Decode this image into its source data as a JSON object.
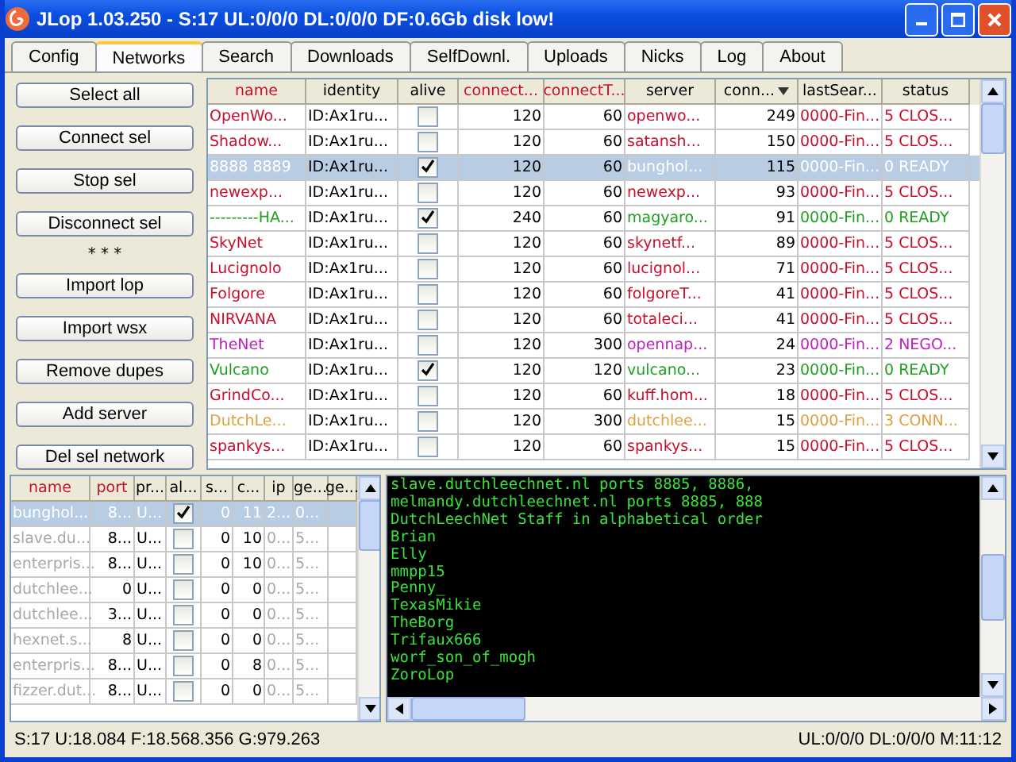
{
  "window": {
    "title": "JLop 1.03.250 - S:17 UL:0/0/0 DL:0/0/0  DF:0.6Gb disk low!"
  },
  "tabs": [
    {
      "label": "Config",
      "selected": false
    },
    {
      "label": "Networks",
      "selected": true
    },
    {
      "label": "Search",
      "selected": false
    },
    {
      "label": "Downloads",
      "selected": false
    },
    {
      "label": "SelfDownl.",
      "selected": false
    },
    {
      "label": "Uploads",
      "selected": false
    },
    {
      "label": "Nicks",
      "selected": false
    },
    {
      "label": "Log",
      "selected": false
    },
    {
      "label": "About",
      "selected": false
    }
  ],
  "sidebar": {
    "buttons": [
      "Select all",
      "Connect sel",
      "Stop sel",
      "Disconnect sel"
    ],
    "separator": "* * *",
    "buttons_2": [
      "Import lop",
      "Import wsx",
      "Remove dupes",
      "Add server",
      "Del sel network"
    ]
  },
  "networks_table": {
    "columns": [
      "name",
      "identity",
      "alive",
      "connect...",
      "connectT...",
      "server",
      "conn...",
      "lastSear...",
      "status"
    ],
    "rows": [
      {
        "name": "OpenWo...",
        "identity": "ID:Ax1ru...",
        "alive": false,
        "connect": "120",
        "connectT": "60",
        "server": "openwo...",
        "conn": "249",
        "lastSearch": "0000-Fin...",
        "status": "5 CLOS...",
        "color": "#c8102e",
        "selected": false
      },
      {
        "name": "Shadow...",
        "identity": "ID:Ax1ru...",
        "alive": false,
        "connect": "120",
        "connectT": "60",
        "server": "satansh...",
        "conn": "150",
        "lastSearch": "0000-Fin...",
        "status": "5 CLOS...",
        "color": "#c8102e",
        "selected": false
      },
      {
        "name": "8888 8889",
        "identity": "ID:Ax1ru...",
        "alive": true,
        "connect": "120",
        "connectT": "60",
        "server": "bunghol...",
        "conn": "115",
        "lastSearch": "0000-Fin...",
        "status": "0 READY",
        "selected": true
      },
      {
        "name": "newexp...",
        "identity": "ID:Ax1ru...",
        "alive": false,
        "connect": "120",
        "connectT": "60",
        "server": "newexp...",
        "conn": "93",
        "lastSearch": "0000-Fin...",
        "status": "5 CLOS...",
        "color": "#c8102e",
        "selected": false
      },
      {
        "name": "---------HA...",
        "identity": "ID:Ax1ru...",
        "alive": true,
        "connect": "240",
        "connectT": "60",
        "server": "magyaro...",
        "conn": "91",
        "lastSearch": "0000-Fin...",
        "status": "0 READY",
        "color": "#20a020",
        "selected": false
      },
      {
        "name": "SkyNet",
        "identity": "ID:Ax1ru...",
        "alive": false,
        "connect": "120",
        "connectT": "60",
        "server": "skynetf...",
        "conn": "89",
        "lastSearch": "0000-Fin...",
        "status": "5 CLOS...",
        "color": "#c8102e",
        "selected": false
      },
      {
        "name": "Lucignolo",
        "identity": "ID:Ax1ru...",
        "alive": false,
        "connect": "120",
        "connectT": "60",
        "server": "lucignol...",
        "conn": "71",
        "lastSearch": "0000-Fin...",
        "status": "5 CLOS...",
        "color": "#c8102e",
        "selected": false
      },
      {
        "name": "Folgore",
        "identity": "ID:Ax1ru...",
        "alive": false,
        "connect": "120",
        "connectT": "60",
        "server": "folgoreT...",
        "conn": "41",
        "lastSearch": "0000-Fin...",
        "status": "5 CLOS...",
        "color": "#c8102e",
        "selected": false
      },
      {
        "name": "NIRVANA",
        "identity": "ID:Ax1ru...",
        "alive": false,
        "connect": "120",
        "connectT": "60",
        "server": "totaleci...",
        "conn": "41",
        "lastSearch": "0000-Fin...",
        "status": "5 CLOS...",
        "color": "#c8102e",
        "selected": false
      },
      {
        "name": "TheNet",
        "identity": "ID:Ax1ru...",
        "alive": false,
        "connect": "120",
        "connectT": "300",
        "server": "opennap...",
        "conn": "24",
        "lastSearch": "0000-Fin...",
        "status": "2 NEGO...",
        "color": "#c020c0",
        "selected": false
      },
      {
        "name": "Vulcano",
        "identity": "ID:Ax1ru...",
        "alive": true,
        "connect": "120",
        "connectT": "120",
        "server": "vulcano...",
        "conn": "23",
        "lastSearch": "0000-Fin...",
        "status": "0 READY",
        "color": "#20a020",
        "selected": false
      },
      {
        "name": "GrindCo...",
        "identity": "ID:Ax1ru...",
        "alive": false,
        "connect": "120",
        "connectT": "60",
        "server": "kuff.hom...",
        "conn": "18",
        "lastSearch": "0000-Fin...",
        "status": "5 CLOS...",
        "color": "#c8102e",
        "selected": false
      },
      {
        "name": "DutchLe...",
        "identity": "ID:Ax1ru...",
        "alive": false,
        "connect": "120",
        "connectT": "300",
        "server": "dutchlee...",
        "conn": "15",
        "lastSearch": "0000-Fin...",
        "status": "3 CONN...",
        "color": "#e0a040",
        "selected": false
      },
      {
        "name": "spankys...",
        "identity": "ID:Ax1ru...",
        "alive": false,
        "connect": "120",
        "connectT": "60",
        "server": "spankys...",
        "conn": "15",
        "lastSearch": "0000-Fin...",
        "status": "5 CLOS...",
        "color": "#c8102e",
        "selected": false
      }
    ]
  },
  "servers_table": {
    "columns": [
      "name",
      "port",
      "pr...",
      "al...",
      "s...",
      "c...",
      "ip",
      "ge...",
      "ge..."
    ],
    "rows": [
      {
        "name": "bunghol...",
        "port": "8...",
        "pr": "U...",
        "alive": true,
        "s": "0",
        "c": "11",
        "ip": "2...",
        "ge": "0...",
        "selected": true
      },
      {
        "name": "slave.du...",
        "port": "8...",
        "pr": "U...",
        "alive": false,
        "s": "0",
        "c": "10",
        "ip": "0...",
        "ge": "5...",
        "selected": false
      },
      {
        "name": "enterpris...",
        "port": "8...",
        "pr": "U...",
        "alive": false,
        "s": "0",
        "c": "10",
        "ip": "0...",
        "ge": "5...",
        "selected": false
      },
      {
        "name": "dutchlee...",
        "port": "0",
        "pr": "U...",
        "alive": false,
        "s": "0",
        "c": "0",
        "ip": "0...",
        "ge": "5...",
        "selected": false
      },
      {
        "name": "dutchlee...",
        "port": "3...",
        "pr": "U...",
        "alive": false,
        "s": "0",
        "c": "0",
        "ip": "0...",
        "ge": "5...",
        "selected": false
      },
      {
        "name": "hexnet.s...",
        "port": "8",
        "pr": "U...",
        "alive": false,
        "s": "0",
        "c": "0",
        "ip": "0...",
        "ge": "5...",
        "selected": false
      },
      {
        "name": "enterpris...",
        "port": "8...",
        "pr": "U...",
        "alive": false,
        "s": "0",
        "c": "8",
        "ip": "0...",
        "ge": "5...",
        "selected": false
      },
      {
        "name": "fizzer.dut...",
        "port": "8...",
        "pr": "U...",
        "alive": false,
        "s": "0",
        "c": "0",
        "ip": "0...",
        "ge": "5...",
        "selected": false
      }
    ]
  },
  "console": {
    "lines": [
      "slave.dutchleechnet.nl ports 8885, 8886,",
      "melmandy.dutchleechnet.nl ports 8885, 888",
      "DutchLeechNet Staff in alphabetical order",
      "Brian",
      "Elly",
      "mmpp15",
      "Penny_",
      "TexasMikie",
      "TheBorg",
      "Trifaux666",
      "worf_son_of_mogh",
      "ZoroLop"
    ]
  },
  "status_bar": {
    "left": "S:17 U:18.084 F:18.568.356 G:979.263",
    "right": "UL:0/0/0 DL:0/0/0  M:11:12"
  }
}
